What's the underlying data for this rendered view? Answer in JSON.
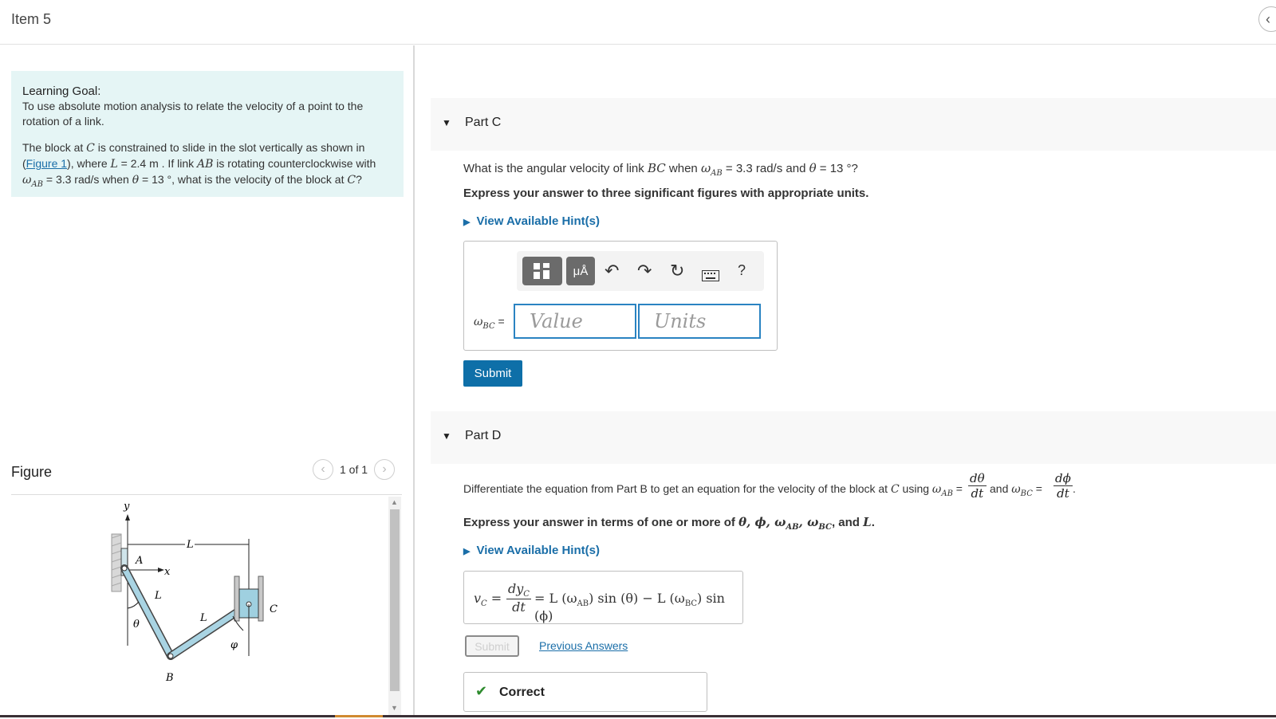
{
  "header": {
    "item_title": "Item 5",
    "collapse_icon": "chevron-left-icon"
  },
  "goal": {
    "heading": "Learning Goal:",
    "text": "To use absolute motion analysis to relate the velocity of a point to the rotation of a link.",
    "problem_start": "The block at ",
    "c": "C",
    "problem_mid1": " is constrained to slide in the slot vertically as shown in (",
    "figure_link": "Figure 1",
    "problem_mid2": "), where ",
    "L_eq": "L",
    "L_val": " = 2.4 m . If link ",
    "AB": "AB",
    "problem_mid3": " is rotating counterclockwise with ",
    "omega_ab": "ω",
    "omega_ab_sub": "AB",
    "problem_mid4": " = 3.3 rad/s when ",
    "theta": "θ",
    "problem_end": " = 13 °, what is the velocity of the block at ",
    "c2": "C",
    "qmark": "?"
  },
  "figure": {
    "title": "Figure",
    "pager": "1 of 1",
    "labels": {
      "y": "y",
      "x": "x",
      "A": "A",
      "B": "B",
      "C": "C",
      "L1": "L",
      "L2": "L",
      "L3": "L",
      "theta": "θ",
      "phi": "φ"
    }
  },
  "partC": {
    "label": "Part C",
    "q_start": "What is the angular velocity of link ",
    "q_bc": "BC",
    "q_mid": " when ",
    "q_omega": "ω",
    "q_omega_sub": "AB",
    "q_mid2": " = 3.3 rad/s and ",
    "q_theta": "θ",
    "q_end": " = 13 °?",
    "instruction": "Express your answer to three significant figures with appropriate units.",
    "hint": "View Available Hint(s)",
    "toolbar": {
      "templates_icon": "templates-icon",
      "units_label": "μÅ",
      "undo_icon": "undo-icon",
      "redo_icon": "redo-icon",
      "reset_icon": "reset-icon",
      "keyboard_icon": "keyboard-icon",
      "help": "?"
    },
    "answer_label": "ω",
    "answer_label_sub": "BC",
    "answer_eq": " =",
    "value_placeholder": "Value",
    "units_placeholder": "Units",
    "submit": "Submit"
  },
  "partD": {
    "label": "Part D",
    "q_start": "Differentiate the equation from Part B to get an equation for the velocity of the block at ",
    "q_c": "C",
    "q_using": " using ",
    "q_omega_ab": "ω",
    "q_omega_ab_sub": "AB",
    "q_eq1": " = ",
    "q_dtheta": "dθ",
    "q_dt": "dt",
    "q_and": " and ",
    "q_omega_bc": "ω",
    "q_omega_bc_sub": "BC",
    "q_eq2": " = ",
    "q_dphi": "dϕ",
    "q_dt2": "dt",
    "q_dot": ".",
    "instruction_start": "Express your answer in terms of one or more of ",
    "instruction_vars": "θ, ϕ, ω",
    "instruction_sub1": "AB",
    "instruction_comma": ", ω",
    "instruction_sub2": "BC",
    "instruction_end": ", and ",
    "instruction_L": "L",
    "instruction_dot": ".",
    "hint": "View Available Hint(s)",
    "answer_lhs": "v",
    "answer_lhs_sub": "C",
    "answer_eq": " = ",
    "answer_num": "dy",
    "answer_num_sub": "C",
    "answer_den": "dt",
    "answer_eq2": " = ",
    "answer_rhs": "L (ω",
    "answer_rhs_sub1": "AB",
    "answer_rhs_mid": ") sin (θ) − L (ω",
    "answer_rhs_sub2": "BC",
    "answer_rhs_end": ") sin (ϕ)",
    "submit": "Submit",
    "previous": "Previous Answers",
    "correct": "Correct"
  }
}
